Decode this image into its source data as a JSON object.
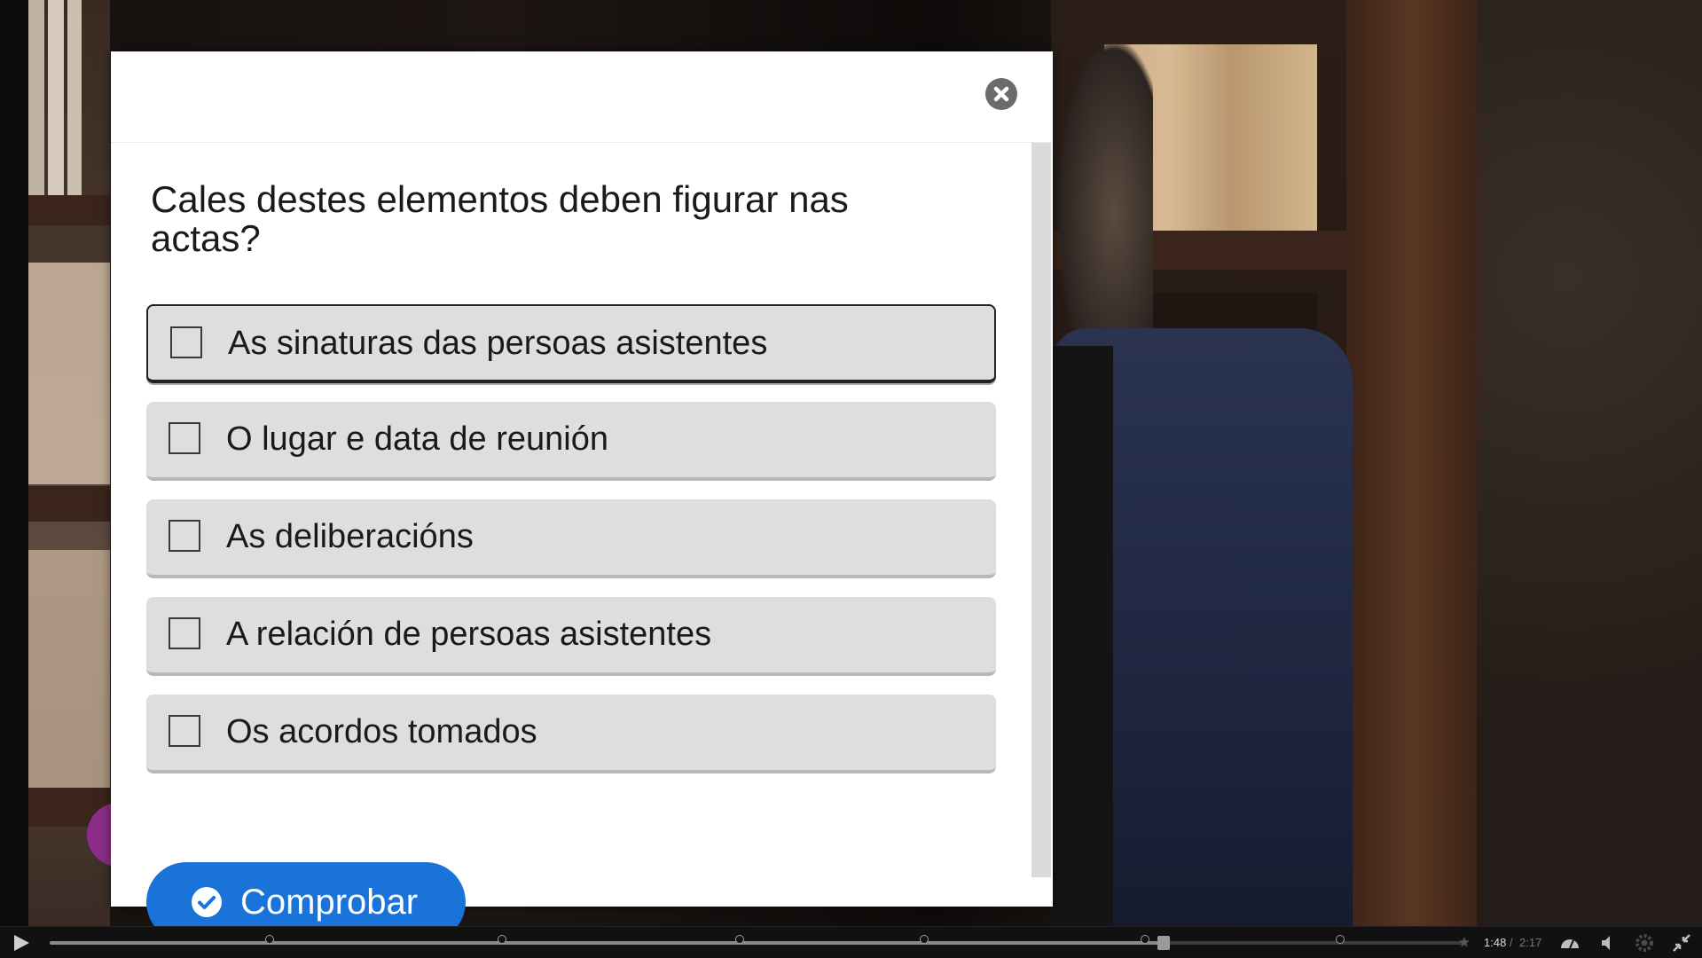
{
  "quiz": {
    "question": "Cales destes elementos deben figurar nas actas?",
    "options": [
      {
        "label": "As sinaturas das persoas asistentes",
        "checked": false
      },
      {
        "label": "O lugar e data de reunión",
        "checked": false
      },
      {
        "label": "As deliberacións",
        "checked": false
      },
      {
        "label": "A relación de persoas asistentes",
        "checked": false
      },
      {
        "label": "Os acordos tomados",
        "checked": false
      }
    ],
    "check_button_label": "Comprobar",
    "accent_color": "#1a73d9"
  },
  "player": {
    "time_current": "1:48",
    "time_separator": "/",
    "time_total": "2:17",
    "progress_fraction": 0.788,
    "icons": [
      "play-icon",
      "speed-icon",
      "volume-icon",
      "settings-icon",
      "exit-fullscreen-icon"
    ]
  }
}
